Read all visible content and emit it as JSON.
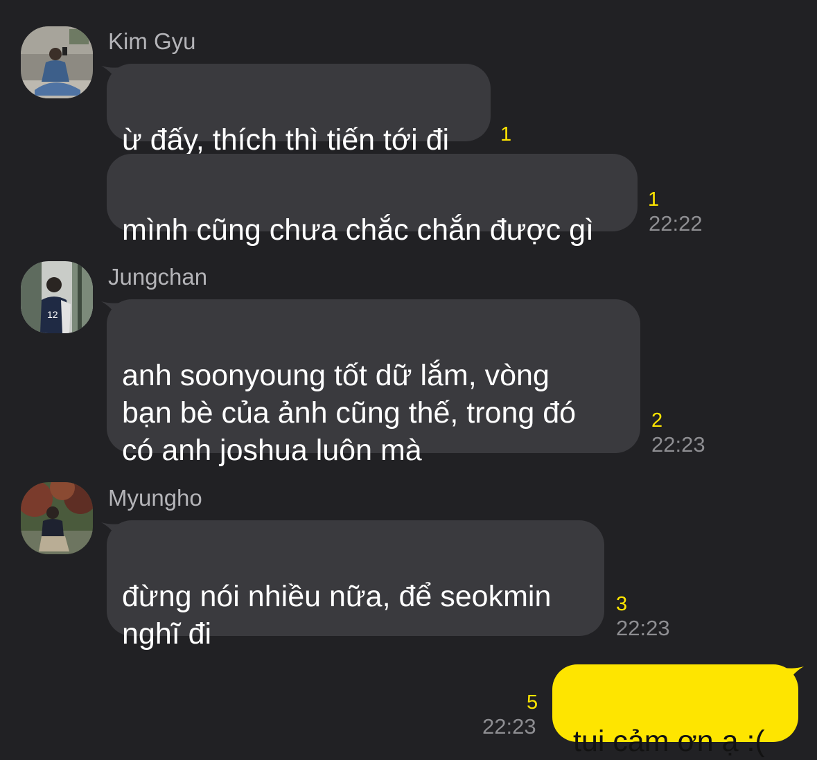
{
  "colors": {
    "background": "#212124",
    "incoming_bubble": "#3a3a3e",
    "outgoing_bubble": "#fee500",
    "unread_count": "#fee500",
    "timestamp": "#8e8e92",
    "sender_name": "#b4b4b8"
  },
  "messages": [
    {
      "sender": "Kim Gyu",
      "avatar_icon": "profile-photo-icon",
      "bubbles": [
        {
          "text": "ừ đấy, thích thì tiến tới đi",
          "unread": "1",
          "time": ""
        },
        {
          "text": "mình cũng chưa chắc chắn được gì",
          "unread": "1",
          "time": "22:22"
        }
      ]
    },
    {
      "sender": "Jungchan",
      "avatar_icon": "profile-photo-icon",
      "bubbles": [
        {
          "text": "anh soonyoung tốt dữ lắm, vòng\nbạn bè của ảnh cũng thế, trong đó\ncó anh joshua luôn mà",
          "unread": "2",
          "time": "22:23"
        }
      ]
    },
    {
      "sender": "Myungho",
      "avatar_icon": "profile-photo-icon",
      "bubbles": [
        {
          "text": "đừng nói nhiều nữa, để seokmin\nnghĩ đi",
          "unread": "3",
          "time": "22:23"
        }
      ]
    }
  ],
  "my_message": {
    "text": "tui cảm ơn ạ :(",
    "unread": "5",
    "time": "22:23"
  }
}
